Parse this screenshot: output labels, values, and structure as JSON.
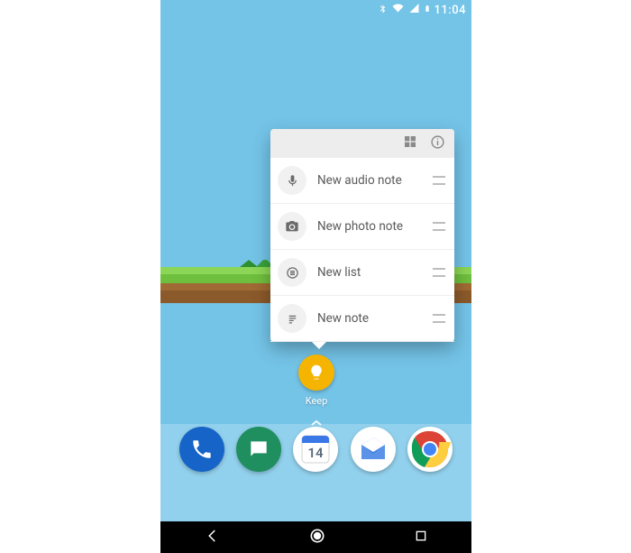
{
  "status": {
    "time": "11:04"
  },
  "popup": {
    "items": [
      {
        "icon": "mic",
        "label": "New audio note"
      },
      {
        "icon": "camera",
        "label": "New photo note"
      },
      {
        "icon": "list",
        "label": "New list"
      },
      {
        "icon": "note",
        "label": "New note"
      }
    ]
  },
  "keep": {
    "label": "Keep"
  },
  "dock": {
    "calendar_day": "14",
    "apps": [
      "phone",
      "messages",
      "calendar",
      "inbox",
      "chrome"
    ]
  }
}
